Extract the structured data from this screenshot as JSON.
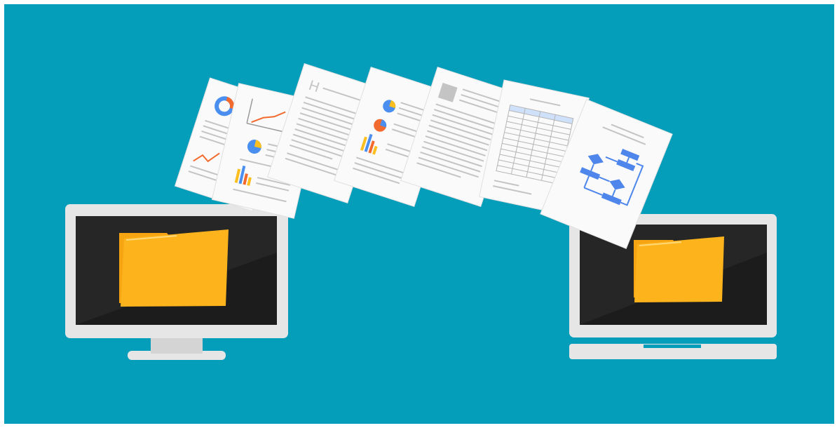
{
  "colors": {
    "background": "#049dba",
    "frame": "#ffffff",
    "monitor_bezel": "#e6e6e6",
    "screen": "#1c1c1c",
    "folder": "#fcb31c",
    "folder_back": "#f7a412",
    "paper": "#fafafa",
    "text_line": "#c4c4c4",
    "flowchart_blue": "#4e86ec",
    "chart_orange": "#f26a2e",
    "chart_yellow": "#fcbf1f",
    "chart_blue": "#4a8ff0"
  },
  "elements": {
    "source_device": "desktop-monitor",
    "target_device": "laptop",
    "folder_icon": "folder-icon",
    "documents": [
      "donut-chart-report",
      "line-chart-report",
      "heading-text-document",
      "pie-chart-report",
      "image-text-document",
      "spreadsheet-document",
      "flowchart-document"
    ]
  },
  "document_heading_letter": "H"
}
